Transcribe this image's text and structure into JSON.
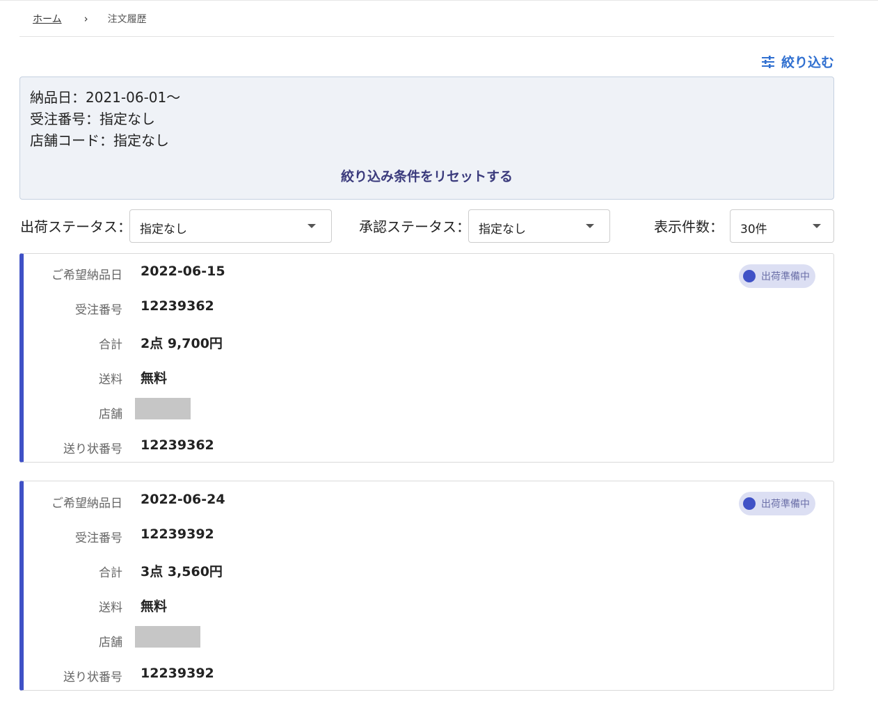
{
  "breadcrumb": {
    "home": "ホーム",
    "separator": "›",
    "current": "注文履歴"
  },
  "filter_button": {
    "label": "絞り込む",
    "icon": "sliders-icon"
  },
  "conditions": {
    "lines": [
      "納品日：2021-06-01〜",
      "受注番号：指定なし",
      "店舗コード：指定なし"
    ],
    "reset_label": "絞り込み条件をリセットする"
  },
  "selects": {
    "shipping": {
      "label": "出荷ステータス：",
      "value": "指定なし"
    },
    "approval": {
      "label": "承認ステータス：",
      "value": "指定なし"
    },
    "per_page": {
      "label": "表示件数：",
      "value": "30件"
    }
  },
  "labels": {
    "delivery_date": "ご希望納品日",
    "order_number": "受注番号",
    "total": "合計",
    "shipping_fee": "送料",
    "store": "店舗",
    "tracking_number": "送り状番号"
  },
  "orders": [
    {
      "status": "出荷準備中",
      "delivery_date": "2022-06-15",
      "order_number": "12239362",
      "total": "2点 9,700円",
      "shipping_fee": "無料",
      "tracking_number": "12239362"
    },
    {
      "status": "出荷準備中",
      "delivery_date": "2022-06-24",
      "order_number": "12239392",
      "total": "3点 3,560円",
      "shipping_fee": "無料",
      "tracking_number": "12239392"
    }
  ],
  "colors": {
    "accent": "#3f51c6",
    "link": "#2f6fd0",
    "condition_bg": "#eff2f7",
    "badge_bg": "#dcdff3"
  }
}
